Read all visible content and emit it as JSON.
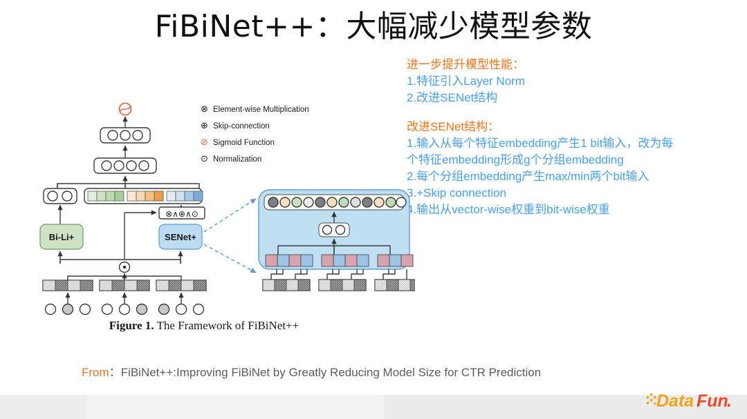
{
  "slide": {
    "title": "FiBiNet++：大幅减少模型参数",
    "caption_prefix": "Figure 1.",
    "caption_text": " The Framework of FiBiNet++",
    "from_label": "From",
    "from_sep": "：",
    "from_value": "FiBiNet++:Improving FiBiNet by Greatly Reducing Model Size for CTR Prediction"
  },
  "colors": {
    "orange": "#F97316",
    "blue": "#45A0F2",
    "from_orange": "#F2711C",
    "caption_black": "#1a1a1a",
    "green_box": "#cfe3c4",
    "blue_box": "#bcdcf2",
    "panel_blue": "#bfdff2",
    "sigmoid_red": "#e05a3a",
    "dash_blue": "#5b9bd5"
  },
  "notes": {
    "section1": {
      "heading": "进一步提升模型性能：",
      "items": [
        "1.特征引入Layer Norm",
        "2.改进SENet结构"
      ]
    },
    "section2": {
      "heading": "改进SENet结构：",
      "items": [
        "1.输入从每个特征embedding产生1 bit输入，改为每",
        "个特征embedding形成g个分组embedding",
        "2.每个分组embedding产生max/min两个bit输入",
        "3.+Skip connection",
        "4.输出从vector-wise权重到bit-wise权重"
      ]
    }
  },
  "diagram": {
    "legend": [
      {
        "symbol": "⊗",
        "label": "Element-wise Multiplication",
        "color": "#1a1a1a"
      },
      {
        "symbol": "⊕",
        "label": "Skip-connection",
        "color": "#1a1a1a"
      },
      {
        "symbol": "⊘",
        "label": "Sigmoid Function",
        "color": "#e05a3a"
      },
      {
        "symbol": "⊙",
        "label": "Normalization",
        "color": "#1a1a1a"
      }
    ],
    "blocks": {
      "bi_li": "Bi-Li+",
      "senet": "SENet+",
      "operator": "⊗∧⊕∧⊙"
    },
    "layers": {
      "output_units": 3,
      "hidden_units": 4,
      "bilinear_units": 2,
      "embedding_groups": 3,
      "embedding_cells_per_group": 4,
      "field_count": 3,
      "field_cells": 4,
      "field_circles": 3
    },
    "panel": {
      "top_circles": 12,
      "mid_units": 2,
      "bottom_groups": 3,
      "bottom_cells_per_group": 4,
      "base_blocks": 3
    }
  },
  "logo": {
    "text_part1": "Data",
    "text_part2": "Fun",
    "text_part3": ".",
    "color1": "#F5A316",
    "color2": "#F04A24"
  }
}
